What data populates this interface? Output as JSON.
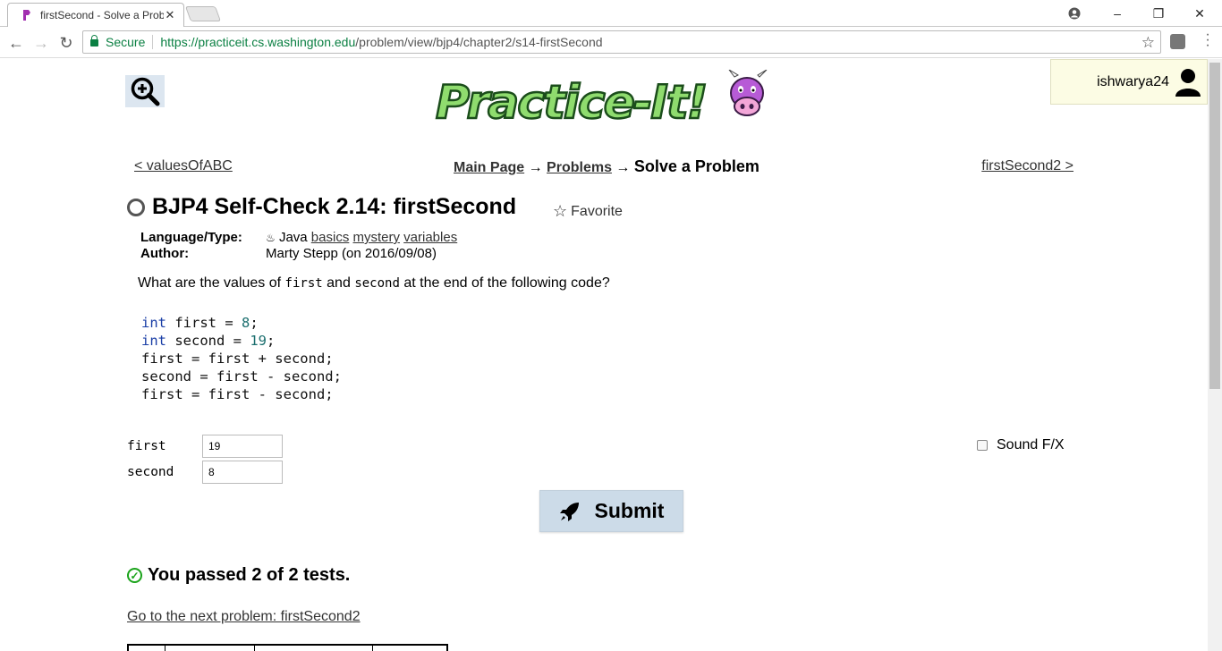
{
  "browser": {
    "tab_title": "firstSecond - Solve a Prob",
    "secure_label": "Secure",
    "url_host": "https://practiceit.cs.washington.edu",
    "url_path": "/problem/view/bjp4/chapter2/s14-firstSecond"
  },
  "header": {
    "username": "ishwarya24",
    "logo_text": "Practice-It!"
  },
  "nav": {
    "prev": "< valuesOfABC",
    "main_page": "Main Page",
    "arrow1": "→",
    "problems": "Problems",
    "arrow2": "→",
    "current": "Solve a Problem",
    "next": "firstSecond2 >"
  },
  "problem": {
    "title": "BJP4 Self-Check 2.14: firstSecond",
    "favorite": "Favorite",
    "language_label": "Language/Type:",
    "language": "Java",
    "tags": [
      "basics",
      "mystery",
      "variables"
    ],
    "author_label": "Author:",
    "author": "Marty Stepp (on 2016/09/08)",
    "question_before": "What are the values of",
    "question_var1": "first",
    "question_and": "and",
    "question_var2": "second",
    "question_after": "at the end of the following code?"
  },
  "code": {
    "l1_kw": "int",
    "l1_rest": " first = ",
    "l1_num": "8",
    "l1_end": ";",
    "l2_kw": "int",
    "l2_rest": " second = ",
    "l2_num": "19",
    "l2_end": ";",
    "l3": "first = first + second;",
    "l4": "second = first - second;",
    "l5": "first = first - second;"
  },
  "answers": {
    "first_label": "first",
    "first_value": "19",
    "second_label": "second",
    "second_value": "8"
  },
  "sound_fx": "Sound F/X",
  "submit": "Submit",
  "result": "You passed 2 of 2 tests.",
  "next_problem": "Go to the next problem: firstSecond2",
  "colors": {
    "accent_green": "#0b8043",
    "pass_green": "#1aa31a",
    "submit_bg": "#ccdbe8"
  }
}
